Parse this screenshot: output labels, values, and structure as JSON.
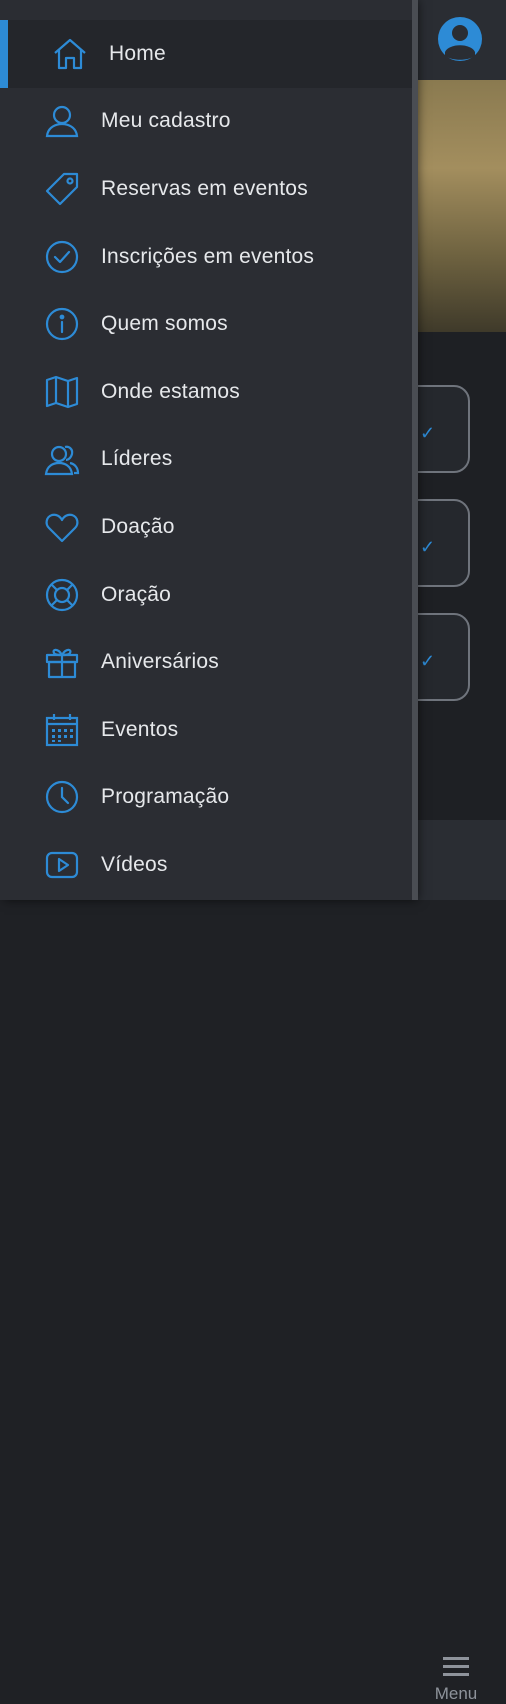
{
  "drawer": {
    "items": [
      {
        "label": "Home",
        "icon": "home-icon",
        "active": true
      },
      {
        "label": "Meu cadastro",
        "icon": "user-icon"
      },
      {
        "label": "Reservas em eventos",
        "icon": "tag-icon"
      },
      {
        "label": "Inscrições em eventos",
        "icon": "check-circle-icon"
      },
      {
        "label": "Quem somos",
        "icon": "info-icon"
      },
      {
        "label": "Onde estamos",
        "icon": "map-icon"
      },
      {
        "label": "Líderes",
        "icon": "users-icon"
      },
      {
        "label": "Doação",
        "icon": "heart-icon"
      },
      {
        "label": "Oração",
        "icon": "lifebuoy-icon"
      },
      {
        "label": "Aniversários",
        "icon": "gift-icon"
      },
      {
        "label": "Eventos",
        "icon": "calendar-icon"
      },
      {
        "label": "Programação",
        "icon": "clock-icon"
      },
      {
        "label": "Vídeos",
        "icon": "video-icon"
      }
    ]
  },
  "bottom_bar": {
    "menu_label": "Menu"
  },
  "colors": {
    "accent": "#2d8bd6",
    "drawer_bg": "#2b2d33",
    "text": "#e6e8eb"
  }
}
